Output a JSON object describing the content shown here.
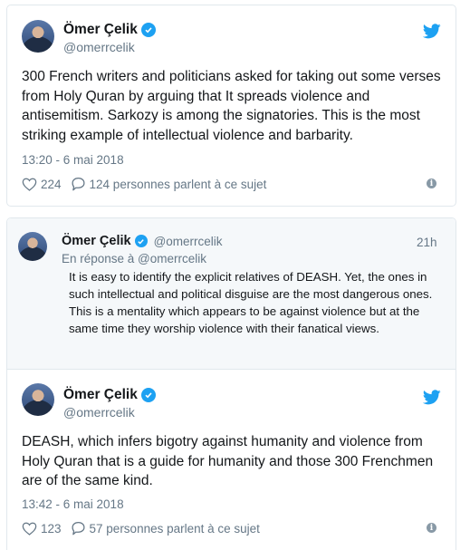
{
  "tweet1": {
    "display_name": "Ömer Çelik",
    "handle": "@omerrcelik",
    "text": "300 French writers and politicians asked for taking out some verses from Holy Quran by arguing that It spreads violence and antisemitism. Sarkozy is among the signatories. This is the most striking example of intellectual violence and barbarity.",
    "timestamp": "13:20 - 6 mai 2018",
    "likes": "224",
    "replies_text": "124 personnes parlent à ce sujet"
  },
  "parent_tweet": {
    "display_name": "Ömer Çelik",
    "handle": "@omerrcelik",
    "time_ago": "21h",
    "reply_to": "En réponse à @omerrcelik",
    "text": "It is easy to identify the explicit relatives of DEASH. Yet, the ones in such intellectual and political disguise are the most dangerous ones. This is a mentality which appears to be against violence but  at the same time they worship violence with their fanatical views."
  },
  "tweet2": {
    "display_name": "Ömer Çelik",
    "handle": "@omerrcelik",
    "text": "DEASH, which infers bigotry against humanity and violence from Holy Quran that is a guide for humanity and those 300 Frenchmen are of the same kind.",
    "timestamp": "13:42 - 6 mai 2018",
    "likes": "123",
    "replies_text": "57 personnes parlent à ce sujet"
  },
  "icons": {
    "verified": "verified-badge-icon",
    "brand": "twitter-bird-icon",
    "like": "heart-icon",
    "reply": "speech-bubble-icon",
    "info": "info-icon"
  },
  "colors": {
    "twitter_blue": "#1da1f2",
    "secondary_text": "#657786",
    "border": "#e1e8ed",
    "parent_bg": "#f5f8fa"
  }
}
